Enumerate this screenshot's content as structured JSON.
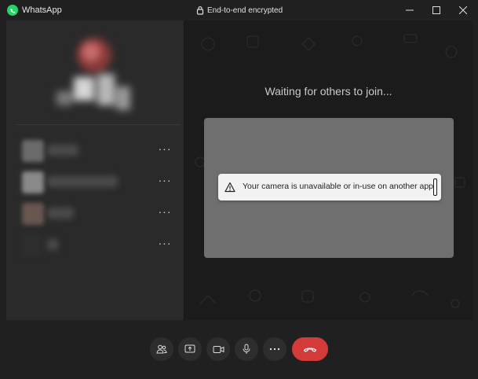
{
  "window": {
    "app_title": "WhatsApp",
    "encryption_label": "End-to-end encrypted",
    "brand_color": "#25d366",
    "icons": [
      "whatsapp-logo",
      "lock-icon",
      "minimize-icon",
      "maximize-icon",
      "close-icon"
    ]
  },
  "participants": {
    "more_label": "···",
    "items": [
      {
        "name": "",
        "thumb_color": "#6b6b6b"
      },
      {
        "name": "",
        "thumb_color": "#8a8a8a"
      },
      {
        "name": "",
        "thumb_color": "#6a5650"
      },
      {
        "name": "",
        "thumb_color": "#2d2d2d"
      }
    ]
  },
  "stage": {
    "waiting_text": "Waiting for others to join...",
    "notice_text": "Your camera is unavailable or in-use on another app",
    "notice_icon": "warning-icon"
  },
  "controls": {
    "buttons": [
      {
        "name": "participants-button",
        "icon": "people-icon"
      },
      {
        "name": "share-screen-button",
        "icon": "share-screen-icon"
      },
      {
        "name": "camera-button",
        "icon": "camera-icon"
      },
      {
        "name": "mic-button",
        "icon": "mic-icon"
      },
      {
        "name": "more-options-button",
        "icon": "more-icon"
      },
      {
        "name": "end-call-button",
        "icon": "hangup-icon"
      }
    ],
    "end_call_color": "#d33b3b"
  }
}
